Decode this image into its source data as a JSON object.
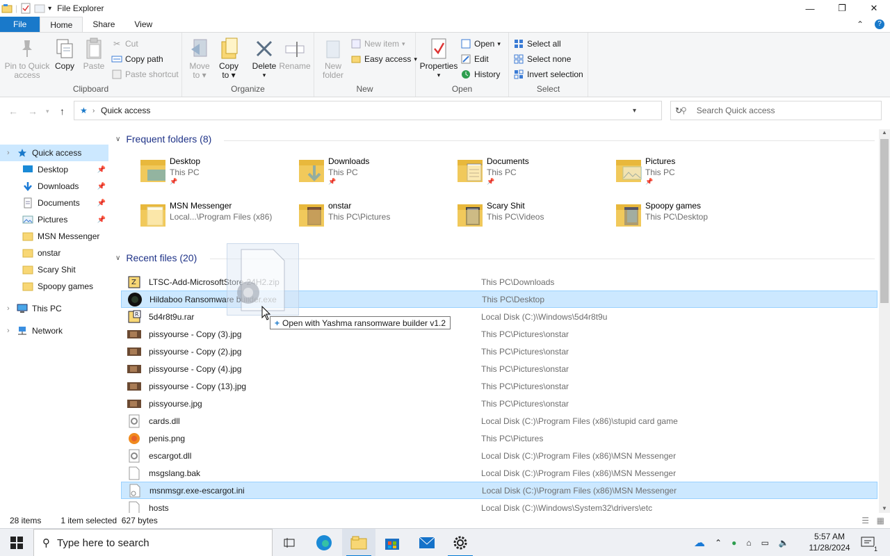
{
  "window": {
    "title": "File Explorer",
    "controls": [
      "—",
      "❐",
      "✕"
    ]
  },
  "ribbon": {
    "tabs": [
      "File",
      "Home",
      "Share",
      "View"
    ],
    "active_tab": "Home",
    "clipboard": {
      "label": "Clipboard",
      "pin": "Pin to Quick\naccess",
      "pin_l1": "Pin to Quick",
      "pin_l2": "access",
      "copy": "Copy",
      "paste": "Paste",
      "cut": "Cut",
      "copy_path": "Copy path",
      "paste_shortcut": "Paste shortcut"
    },
    "organize": {
      "label": "Organize",
      "move_l1": "Move",
      "move_l2": "to",
      "copy_l1": "Copy",
      "copy_l2": "to",
      "delete": "Delete",
      "rename": "Rename"
    },
    "new": {
      "label": "New",
      "new_folder_l1": "New",
      "new_folder_l2": "folder",
      "new_item": "New item",
      "easy_access": "Easy access"
    },
    "open": {
      "label": "Open",
      "properties": "Properties",
      "open": "Open",
      "edit": "Edit",
      "history": "History"
    },
    "select": {
      "label": "Select",
      "select_all": "Select all",
      "select_none": "Select none",
      "invert": "Invert selection"
    }
  },
  "address": {
    "crumb": "Quick access",
    "search_placeholder": "Search Quick access"
  },
  "navpane": {
    "items": [
      {
        "label": "Quick access",
        "icon": "star-icon",
        "pinned": false,
        "selected": true
      },
      {
        "label": "Desktop",
        "icon": "desktop-icon",
        "pinned": true
      },
      {
        "label": "Downloads",
        "icon": "download-icon",
        "pinned": true
      },
      {
        "label": "Documents",
        "icon": "document-icon",
        "pinned": true
      },
      {
        "label": "Pictures",
        "icon": "pictures-icon",
        "pinned": true
      },
      {
        "label": "MSN Messenger",
        "icon": "folder-icon",
        "pinned": false
      },
      {
        "label": "onstar",
        "icon": "folder-icon",
        "pinned": false
      },
      {
        "label": "Scary Shit",
        "icon": "folder-icon",
        "pinned": false
      },
      {
        "label": "Spoopy games",
        "icon": "folder-icon",
        "pinned": false
      },
      {
        "label": "This PC",
        "icon": "computer-icon",
        "pinned": false
      },
      {
        "label": "Network",
        "icon": "network-icon",
        "pinned": false
      }
    ]
  },
  "frequent": {
    "header": "Frequent folders (8)",
    "folders": [
      {
        "name": "Desktop",
        "path": "This PC",
        "pinned": true
      },
      {
        "name": "Downloads",
        "path": "This PC",
        "pinned": true
      },
      {
        "name": "Documents",
        "path": "This PC",
        "pinned": true
      },
      {
        "name": "Pictures",
        "path": "This PC",
        "pinned": true
      },
      {
        "name": "MSN Messenger",
        "path": "Local...\\Program Files (x86)",
        "pinned": false
      },
      {
        "name": "onstar",
        "path": "This PC\\Pictures",
        "pinned": false
      },
      {
        "name": "Scary Shit",
        "path": "This PC\\Videos",
        "pinned": false
      },
      {
        "name": "Spoopy games",
        "path": "This PC\\Desktop",
        "pinned": false
      }
    ]
  },
  "recent": {
    "header": "Recent files (20)",
    "files": [
      {
        "name": "LTSC-Add-MicrosoftStore-24H2.zip",
        "location": "This PC\\Downloads",
        "icon": "zip-icon"
      },
      {
        "name": "Hildaboo Ransomware builder.exe",
        "location": "This PC\\Desktop",
        "icon": "exe-icon",
        "selected": true
      },
      {
        "name": "5d4r8t9u.rar",
        "location": "Local Disk (C:)\\Windows\\5d4r8t9u",
        "icon": "rar-icon"
      },
      {
        "name": "pissyourse - Copy (3).jpg",
        "location": "This PC\\Pictures\\onstar",
        "icon": "image-icon"
      },
      {
        "name": "pissyourse - Copy (2).jpg",
        "location": "This PC\\Pictures\\onstar",
        "icon": "image-icon"
      },
      {
        "name": "pissyourse - Copy (4).jpg",
        "location": "This PC\\Pictures\\onstar",
        "icon": "image-icon"
      },
      {
        "name": "pissyourse - Copy (13).jpg",
        "location": "This PC\\Pictures\\onstar",
        "icon": "image-icon"
      },
      {
        "name": "pissyourse.jpg",
        "location": "This PC\\Pictures\\onstar",
        "icon": "image-icon"
      },
      {
        "name": "cards.dll",
        "location": "Local Disk (C:)\\Program Files (x86)\\stupid card game",
        "icon": "dll-icon"
      },
      {
        "name": "penis.png",
        "location": "This PC\\Pictures",
        "icon": "png-icon"
      },
      {
        "name": "escargot.dll",
        "location": "Local Disk (C:)\\Program Files (x86)\\MSN Messenger",
        "icon": "dll-icon"
      },
      {
        "name": "msgslang.bak",
        "location": "Local Disk (C:)\\Program Files (x86)\\MSN Messenger",
        "icon": "blank-file-icon"
      },
      {
        "name": "msnmsgr.exe-escargot.ini",
        "location": "Local Disk (C:)\\Program Files (x86)\\MSN Messenger",
        "icon": "ini-icon",
        "selected": true
      },
      {
        "name": "hosts",
        "location": "Local Disk (C:)\\Windows\\System32\\drivers\\etc",
        "icon": "blank-file-icon"
      }
    ]
  },
  "drag": {
    "tooltip_plus": "+",
    "tooltip": "Open with Yashma ransomware builder v1.2"
  },
  "status": {
    "items": "28 items",
    "selection": "1 item selected  627 bytes"
  },
  "taskbar": {
    "search_placeholder": "Type here to search",
    "time": "5:57 AM",
    "date": "11/28/2024",
    "notification_count": "1"
  },
  "colors": {
    "accent": "#1979ca",
    "selection": "#cce8ff",
    "section_header": "#1e3287",
    "folder": "#f8d775"
  }
}
